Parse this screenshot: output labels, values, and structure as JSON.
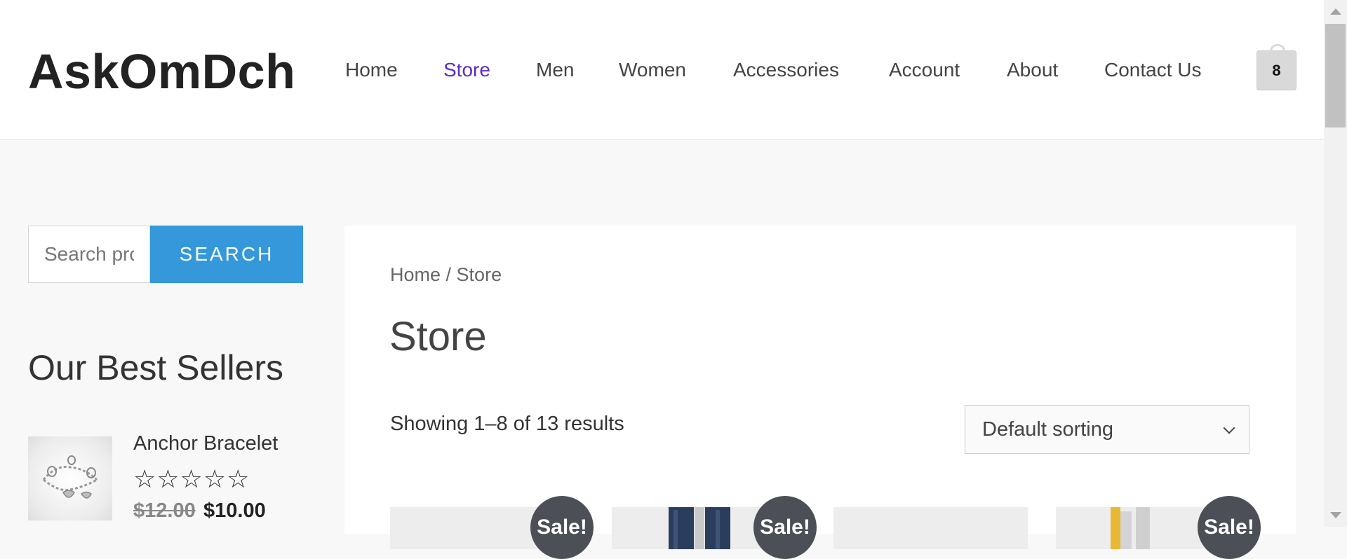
{
  "header": {
    "logo": "AskOmDch",
    "nav": [
      {
        "label": "Home",
        "active": false
      },
      {
        "label": "Store",
        "active": true
      },
      {
        "label": "Men",
        "active": false
      },
      {
        "label": "Women",
        "active": false
      },
      {
        "label": "Accessories",
        "active": false
      },
      {
        "label": "Account",
        "active": false
      },
      {
        "label": "About",
        "active": false
      },
      {
        "label": "Contact Us",
        "active": false
      }
    ],
    "cart_count": "8"
  },
  "sidebar": {
    "search": {
      "placeholder": "Search products…",
      "button_label": "SEARCH"
    },
    "best_sellers": {
      "title": "Our Best Sellers",
      "items": [
        {
          "name": "Anchor Bracelet",
          "old_price": "$12.00",
          "new_price": "$10.00",
          "stars": "☆☆☆☆☆",
          "rating": 0
        }
      ]
    }
  },
  "main": {
    "breadcrumb": {
      "home": "Home",
      "separator": " / ",
      "current": "Store"
    },
    "title": "Store",
    "result_count": "Showing 1–8 of 13 results",
    "sorting": {
      "selected": "Default sorting"
    },
    "products": [
      {
        "sale_badge": "Sale!"
      },
      {
        "sale_badge": "Sale!"
      },
      {
        "sale_badge": ""
      },
      {
        "sale_badge": "Sale!"
      }
    ]
  },
  "colors": {
    "accent": "#5b2bc9",
    "button": "#3498db",
    "badge": "#4c4f55"
  }
}
